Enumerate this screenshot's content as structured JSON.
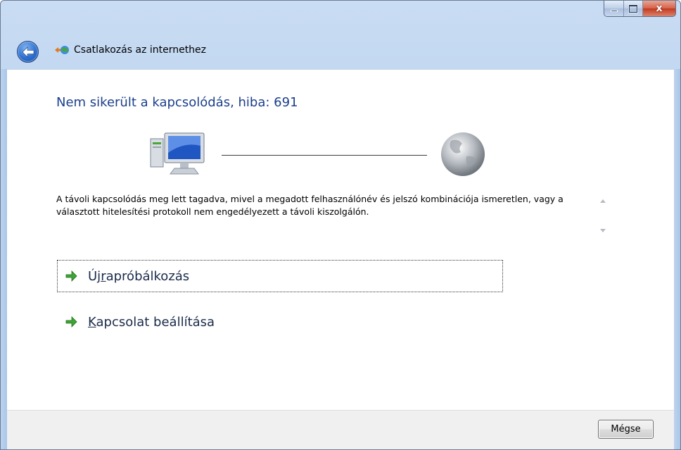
{
  "window": {
    "title": "Csatlakozás az internethez",
    "caption_buttons": {
      "minimize": "minimize",
      "maximize": "maximize",
      "close": "x"
    }
  },
  "nav": {
    "back_icon": "back-arrow-icon",
    "wizard_icon": "network-connect-icon"
  },
  "main": {
    "heading": "Nem sikerült a kapcsolódás, hiba: 691",
    "message": "A távoli kapcsolódás meg lett tagadva, mivel a megadott felhasználónév és jelszó kombinációja ismeretlen, vagy a választott hitelesítési protokoll nem engedélyezett a távoli kiszolgálón.",
    "icons": {
      "left": "computer-icon",
      "right": "globe-icon"
    },
    "commands": [
      {
        "pre": "Új",
        "accel": "r",
        "post": "apróbálkozás",
        "icon": "green-arrow-icon"
      },
      {
        "pre": "",
        "accel": "K",
        "post": "apcsolat beállítása",
        "icon": "green-arrow-icon"
      }
    ]
  },
  "footer": {
    "cancel_label": "Mégse"
  },
  "colors": {
    "heading": "#1b3f8b",
    "frame": "#b9d1ee",
    "close_button": "#c4391d"
  }
}
